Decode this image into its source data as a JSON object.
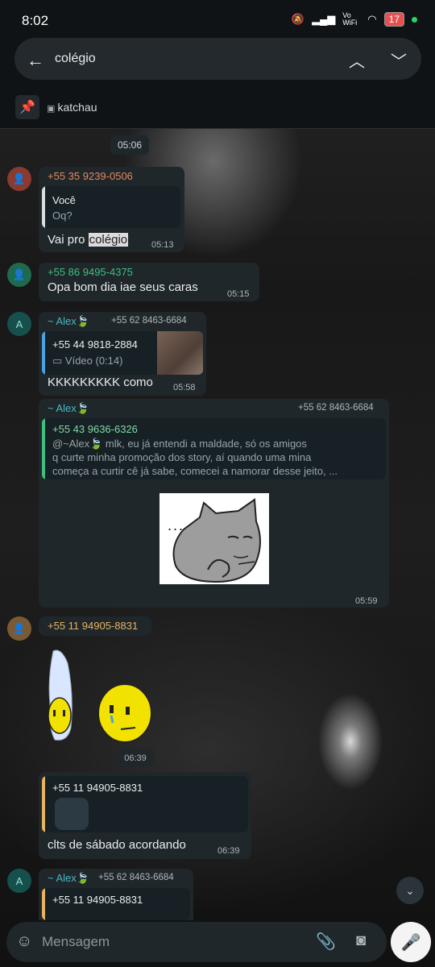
{
  "status_bar": {
    "time": "8:02",
    "network": "Vo WiFi",
    "battery": "17"
  },
  "search": {
    "back_icon": "arrow-left-icon",
    "query": "colégio",
    "up_icon": "chevron-up-icon",
    "down_icon": "chevron-down-icon"
  },
  "pinned": {
    "icon": "pin-icon",
    "label": "katchau"
  },
  "messages": {
    "date_chip": "05:06",
    "m1": {
      "sender": "+55 35 9239-0506",
      "sender_color": "#e6875f",
      "quote_title": "Você",
      "quote_text": "Oq?",
      "text_before": "Vai pro ",
      "highlight": "colégio",
      "time": "05:13"
    },
    "m2": {
      "sender": "+55 86 9495-4375",
      "sender_color": "#3fbf7f",
      "text": "Opa bom dia iae seus caras",
      "time": "05:15"
    },
    "m3": {
      "avatar_letter": "A",
      "sender": "~ Alex🍃",
      "phone": "+55 62 8463-6684",
      "sender_color": "#47b8c7",
      "quote_title": "+55 44 9818-2884",
      "quote_sub": "Vídeo (0:14)",
      "text": "KKKKKKKKK como",
      "time": "05:58"
    },
    "m4": {
      "sender": "~ Alex🍃",
      "phone": "+55 62 8463-6684",
      "quote_title": "+55 43 9636-6326",
      "quote_line1": "@~Alex🍃 mlk, eu já entendi a maldade, só os amigos",
      "quote_line2": "q curte minha promoção dos story, aí quando uma mina",
      "quote_line3": "começa a curtir cê já sabe, comecei a namorar desse jeito, ...",
      "sticker_dots": "...",
      "time": "05:59"
    },
    "m5": {
      "sender": "+55 11 94905-8831",
      "sender_color": "#e6b35f",
      "time": "06:39"
    },
    "m6": {
      "quote_title": "+55 11 94905-8831",
      "text": "clts de sábado acordando",
      "time": "06:39"
    },
    "m7": {
      "avatar_letter": "A",
      "sender": "~ Alex🍃",
      "phone": "+55 62 8463-6684",
      "quote_title": "+55 11 94905-8831"
    }
  },
  "composer": {
    "placeholder": "Mensagem",
    "emoji_icon": "emoji-icon",
    "attach_icon": "paperclip-icon",
    "camera_icon": "camera-icon",
    "mic_icon": "microphone-icon"
  }
}
